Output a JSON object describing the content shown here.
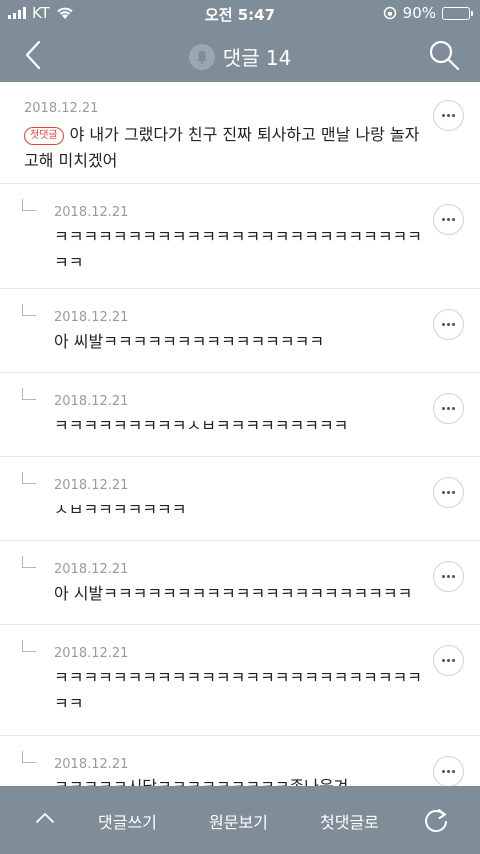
{
  "status": {
    "carrier": "KT",
    "time": "오전 5:47",
    "battery": "90%",
    "battery_level": 0.9
  },
  "header": {
    "title": "댓글 14"
  },
  "comments": [
    {
      "date": "2018.12.21",
      "badge": "첫댓글",
      "text_line1": "야 내가 그랬다가 친구 진짜 퇴사하고 맨날 나랑 놀자",
      "text_line2": "고해 미치겠어"
    },
    {
      "date": "2018.12.21",
      "text_line1": "ㅋㅋㅋㅋㅋㅋㅋㅋㅋㅋㅋㅋㅋㅋㅋㅋㅋㅋㅋㅋㅋㅋㅋㅋㅋ",
      "text_line2": "ㅋㅋ"
    },
    {
      "date": "2018.12.21",
      "text_line1": "아 씨발ㅋㅋㅋㅋㅋㅋㅋㅋㅋㅋㅋㅋㅋㅋㅋ"
    },
    {
      "date": "2018.12.21",
      "text_line1": "ㅋㅋㅋㅋㅋㅋㅋㅋㅋㅅㅂㅋㅋㅋㅋㅋㅋㅋㅋㅋ"
    },
    {
      "date": "2018.12.21",
      "text_line1": "ㅅㅂㅋㅋㅋㅋㅋㅋㅋ"
    },
    {
      "date": "2018.12.21",
      "text_line1": "아 시발ㅋㅋㅋㅋㅋㅋㅋㅋㅋㅋㅋㅋㅋㅋㅋㅋㅋㅋㅋㅋㅋ"
    },
    {
      "date": "2018.12.21",
      "text_line1": "ㅋㅋㅋㅋㅋㅋㅋㅋㅋㅋㅋㅋㅋㅋㅋㅋㅋㅋㅋㅋㅋㅋㅋㅋㅋ",
      "text_line2": "ㅋㅋ"
    },
    {
      "date": "2018.12.21",
      "text_line1": "ㅋㅋㅋㅋㅋ시닼ㅋㅋㅋㅋㅋㅋㅋㅋㅋ존나웃겨"
    }
  ],
  "toolbar": {
    "write_label": "댓글쓰기",
    "original_label": "원문보기",
    "first_label": "첫댓글로"
  }
}
